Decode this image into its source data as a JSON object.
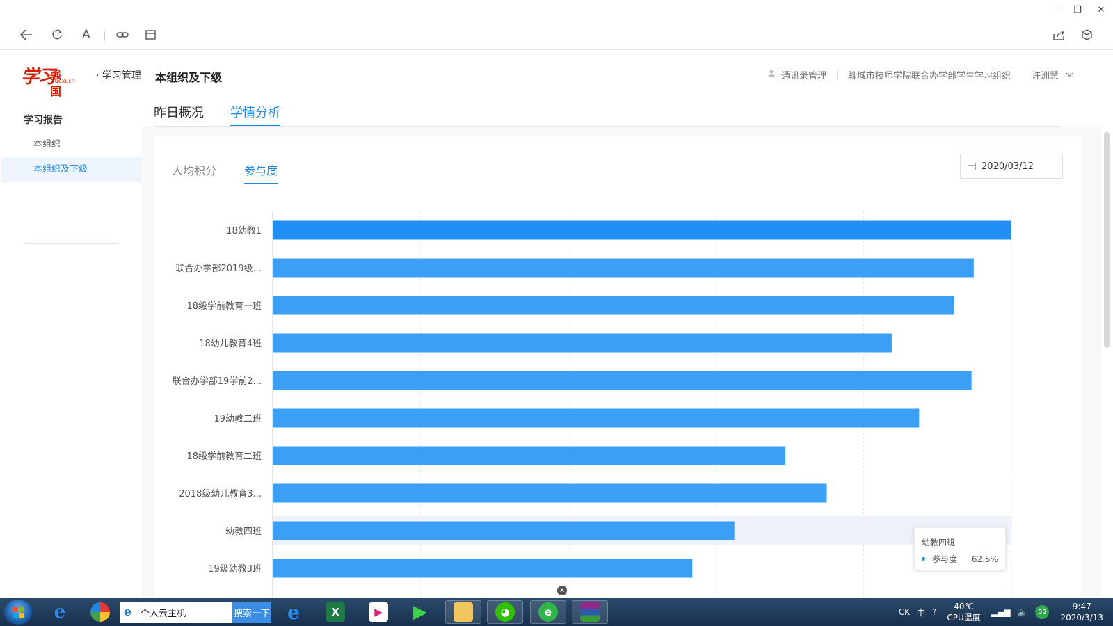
{
  "window": {
    "controls": [
      "—",
      "❐",
      "✕"
    ]
  },
  "toolbar": {
    "icons": [
      "back-icon",
      "refresh-icon",
      "font-icon",
      "link-icon",
      "window-icon",
      "share-icon",
      "cube-icon"
    ],
    "font_glyph": "A"
  },
  "sidebar": {
    "logo_main": "学习",
    "logo_sub": "强国",
    "logo_url": "xuexi.cn",
    "logo_suffix": "· 学习管理",
    "section_title": "学习报告",
    "items": [
      {
        "label": "本组织",
        "active": false
      },
      {
        "label": "本组织及下级",
        "active": true
      }
    ]
  },
  "header": {
    "title": "本组织及下级",
    "contacts_label": "通讯录管理",
    "org_name": "聊城市技师学院联合办学部学生学习组织",
    "user_name": "许洲慧"
  },
  "main_tabs": [
    {
      "label": "昨日概况",
      "active": false
    },
    {
      "label": "学情分析",
      "active": true
    }
  ],
  "sub_tabs": [
    {
      "label": "人均积分",
      "active": false
    },
    {
      "label": "参与度",
      "active": true
    }
  ],
  "date_picker": {
    "value": "2020/03/12"
  },
  "tooltip": {
    "title": "幼教四班",
    "series": "参与度",
    "value": "62.5%"
  },
  "chart_data": {
    "type": "bar",
    "orientation": "horizontal",
    "categories": [
      "18幼教1",
      "联合办学部2019级...",
      "18级学前教育一班",
      "18幼儿教育4班",
      "联合办学部19学前2...",
      "19幼教二班",
      "18级学前教育二班",
      "2018级幼儿教育3...",
      "幼教四班",
      "19级幼教3班"
    ],
    "series": [
      {
        "name": "参与度",
        "values": [
          100,
          94.9,
          92.2,
          83.8,
          94.6,
          87.5,
          69.4,
          75.0,
          62.5,
          56.8
        ]
      }
    ],
    "xlim": [
      0,
      100
    ],
    "grid": true,
    "highlighted_category": "幼教四班",
    "bar_color": "#3a9ff5",
    "highlight_color": "#2090f5"
  },
  "taskbar": {
    "search_text": "个人云主机",
    "search_button": "搜索一下",
    "apps": [
      "ie-icon",
      "pinwheel-icon",
      "ie-icon",
      "excel-icon",
      "youku-icon",
      "video-player-icon",
      "file-explorer-icon",
      "wechat-icon",
      "browser-360-icon",
      "winrar-icon"
    ],
    "tray": {
      "ime_label": "CK",
      "ime_lang": "中",
      "temperature": "40℃",
      "temp_label": "CPU温度",
      "badge": "52",
      "time": "9:47",
      "date": "2020/3/13"
    }
  }
}
